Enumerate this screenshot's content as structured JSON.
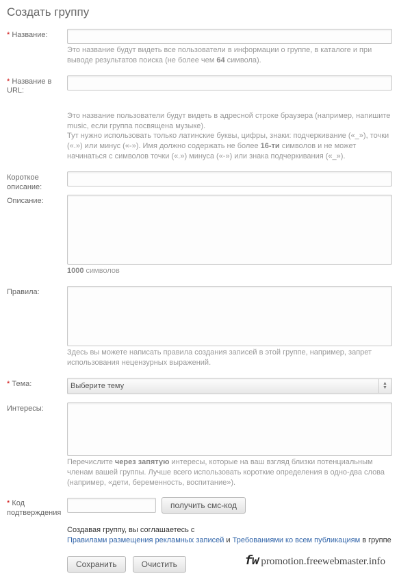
{
  "title": "Создать группу",
  "fields": {
    "name": {
      "label": "Название:",
      "hint_a": "Это название будут видеть все пользователи в информации о группе, в каталоге и при выводе результатов поиска (не более чем ",
      "hint_b": "64",
      "hint_c": " символа)."
    },
    "url": {
      "label": "Название в URL:",
      "hint1": "Это название пользователи будут видеть в адресной строке браузера (например, напишите music, если группа посвящена музыке).",
      "hint2a": "Тут нужно использовать только латинские буквы, цифры, знаки: подчеркивание («_»), точки («.») или минус («-»). Имя должно содержать не более ",
      "hint2b": "16-ти",
      "hint2c": " символов и не может начинаться с символов точки («.») минуса («-») или знака подчеркивания («_»)."
    },
    "short": {
      "label": "Короткое описание:"
    },
    "desc": {
      "label": "Описание:",
      "counter_a": "1000",
      "counter_b": " символов"
    },
    "rules": {
      "label": "Правила:",
      "hint": "Здесь вы можете написать правила создания записей в этой группе, например, запрет использования нецензурных выражений."
    },
    "theme": {
      "label": "Тема:",
      "selected": "Выберите тему"
    },
    "interests": {
      "label": "Интересы:",
      "hint_a": "Перечислите ",
      "hint_b": "через запятую",
      "hint_c": " интересы, которые на ваш взгляд близки потенциальным членам вашей группы. Лучше всего использовать короткие определения в одно-два слова (например, «дети, беременность, воспитание»)."
    },
    "code": {
      "label": "Код подтверждения",
      "button": "получить смс-код"
    }
  },
  "agree": {
    "lead": "Создавая группу, вы соглашаетесь с",
    "link1": "Правилами размещения рекламных записей",
    "mid": " и ",
    "link2": "Требованиями ко всем публикациям",
    "tail": " в группе"
  },
  "actions": {
    "save": "Сохранить",
    "clear": "Очистить"
  },
  "watermark": {
    "logo": "fw",
    "text": " promotion.freewebmaster.info"
  }
}
